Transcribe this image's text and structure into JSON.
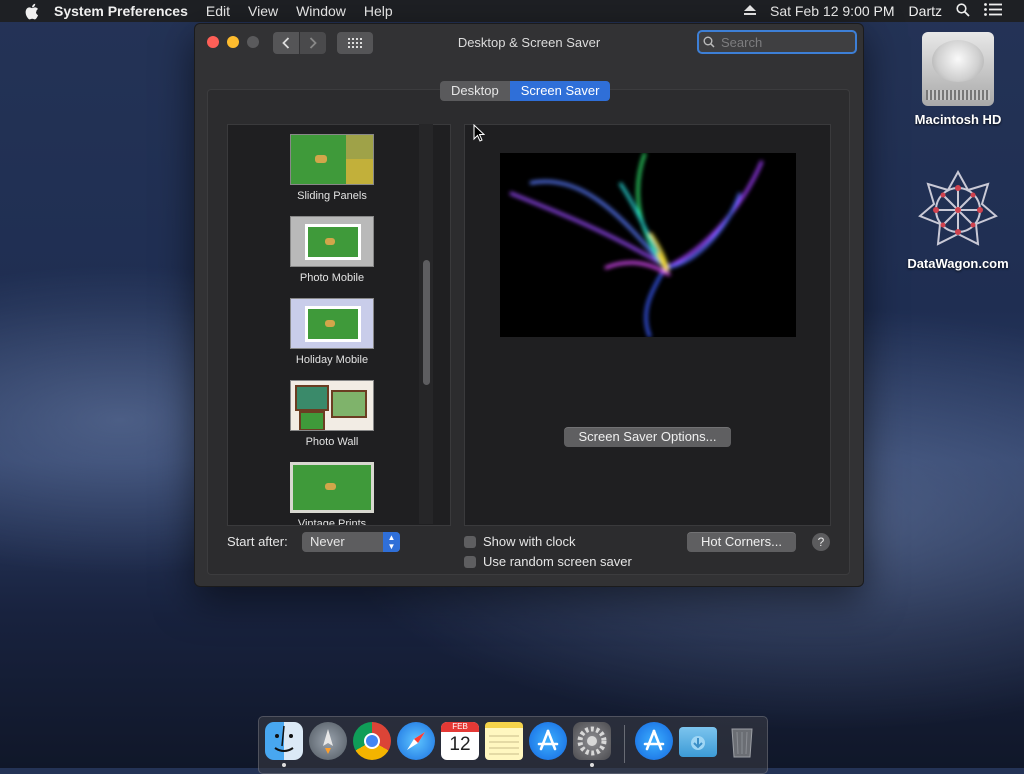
{
  "menubar": {
    "apple_icon": "apple-icon",
    "app_name": "System Preferences",
    "menus": [
      "Edit",
      "View",
      "Window",
      "Help"
    ],
    "datetime": "Sat Feb 12  9:00 PM",
    "user": "Dartz"
  },
  "window": {
    "title": "Desktop & Screen Saver",
    "search_placeholder": "Search",
    "tabs": [
      {
        "label": "Desktop",
        "selected": false
      },
      {
        "label": "Screen Saver",
        "selected": true
      }
    ],
    "savers": [
      {
        "label": "Sliding Panels"
      },
      {
        "label": "Photo Mobile"
      },
      {
        "label": "Holiday Mobile"
      },
      {
        "label": "Photo Wall"
      },
      {
        "label": "Vintage Prints"
      }
    ],
    "options_button": "Screen Saver Options...",
    "start_after_label": "Start after:",
    "start_after_value": "Never",
    "show_clock_label": "Show with clock",
    "random_label": "Use random screen saver",
    "hot_corners_button": "Hot Corners...",
    "help_label": "?"
  },
  "desktop": {
    "icons": [
      {
        "label": "Macintosh HD"
      },
      {
        "label": "DataWagon.com"
      }
    ]
  },
  "dock": {
    "apps": [
      "finder-icon",
      "launchpad-icon",
      "chrome-icon",
      "safari-icon",
      "calendar-icon",
      "notes-icon",
      "app-store-icon",
      "system-preferences-icon",
      "app-store-icon",
      "downloads-folder-icon",
      "trash-icon"
    ],
    "calendar_month": "FEB",
    "calendar_day": "12",
    "colors": {
      "accent": "#2f6fd8",
      "close": "#fe5f57",
      "minimize": "#febc2e"
    }
  }
}
